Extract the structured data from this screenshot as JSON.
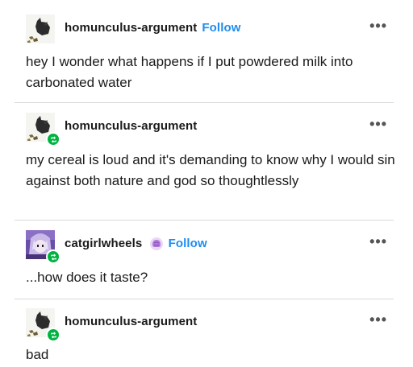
{
  "posts": [
    {
      "username": "homunculus-argument",
      "follow_label": "Follow",
      "more_label": "•••",
      "text": "hey I wonder what happens if I put powdered milk into carbonated water",
      "avatar_icon": "dog-in-field-avatar",
      "reblog": false
    },
    {
      "username": "homunculus-argument",
      "more_label": "•••",
      "text": "my cereal is loud and it's demanding to know why I would sin against both nature and god so thoughtlessly",
      "avatar_icon": "dog-in-field-avatar",
      "reblog": true
    },
    {
      "username": "catgirlwheels",
      "follow_label": "Follow",
      "more_label": "•••",
      "text": "...how does it taste?",
      "avatar_icon": "anime-character-avatar",
      "badge_icon": "brain-badge-icon",
      "reblog": true
    },
    {
      "username": "homunculus-argument",
      "more_label": "•••",
      "text": "bad",
      "avatar_icon": "dog-in-field-avatar",
      "reblog": true
    }
  ],
  "colors": {
    "follow": "#1d8cf0",
    "reblog_badge": "#00b341",
    "divider": "#d9d9d9"
  }
}
